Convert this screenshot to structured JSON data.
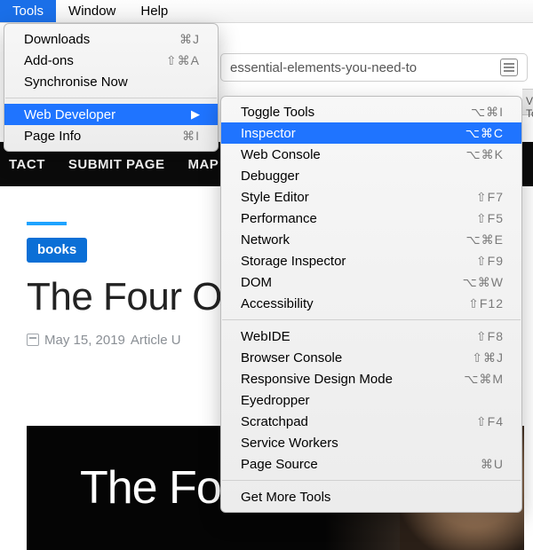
{
  "menubar": {
    "tools": "Tools",
    "window": "Window",
    "help": "Help"
  },
  "tools_menu": {
    "downloads": {
      "label": "Downloads",
      "shortcut": "⌘J"
    },
    "addons": {
      "label": "Add-ons",
      "shortcut": "⇧⌘A"
    },
    "sync": {
      "label": "Synchronise Now",
      "shortcut": ""
    },
    "webdev": {
      "label": "Web Developer"
    },
    "pageinfo": {
      "label": "Page Info",
      "shortcut": "⌘I"
    }
  },
  "webdev_menu": {
    "toggle": {
      "label": "Toggle Tools",
      "shortcut": "⌥⌘I"
    },
    "inspector": {
      "label": "Inspector",
      "shortcut": "⌥⌘C"
    },
    "console": {
      "label": "Web Console",
      "shortcut": "⌥⌘K"
    },
    "debugger": {
      "label": "Debugger",
      "shortcut": ""
    },
    "style": {
      "label": "Style Editor",
      "shortcut": "⇧F7"
    },
    "perf": {
      "label": "Performance",
      "shortcut": "⇧F5"
    },
    "network": {
      "label": "Network",
      "shortcut": "⌥⌘E"
    },
    "storage": {
      "label": "Storage Inspector",
      "shortcut": "⇧F9"
    },
    "dom": {
      "label": "DOM",
      "shortcut": "⌥⌘W"
    },
    "a11y": {
      "label": "Accessibility",
      "shortcut": "⇧F12"
    },
    "webide": {
      "label": "WebIDE",
      "shortcut": "⇧F8"
    },
    "bconsole": {
      "label": "Browser Console",
      "shortcut": "⇧⌘J"
    },
    "rdm": {
      "label": "Responsive Design Mode",
      "shortcut": "⌥⌘M"
    },
    "eye": {
      "label": "Eyedropper",
      "shortcut": ""
    },
    "scratch": {
      "label": "Scratchpad",
      "shortcut": "⇧F4"
    },
    "workers": {
      "label": "Service Workers",
      "shortcut": ""
    },
    "source": {
      "label": "Page Source",
      "shortcut": "⌘U"
    },
    "more": {
      "label": "Get More Tools",
      "shortcut": ""
    }
  },
  "url_fragment": "essential-elements-you-need-to",
  "tab_fragment": "Veb To",
  "nav": {
    "contact": "TACT",
    "submit": "SUBMIT PAGE",
    "map": "MAP"
  },
  "article": {
    "tag": "books",
    "title": "The Four \nOn Amazo",
    "date": "May 15, 2019",
    "meta_suffix": "Article U",
    "hero_text": "The Four"
  }
}
